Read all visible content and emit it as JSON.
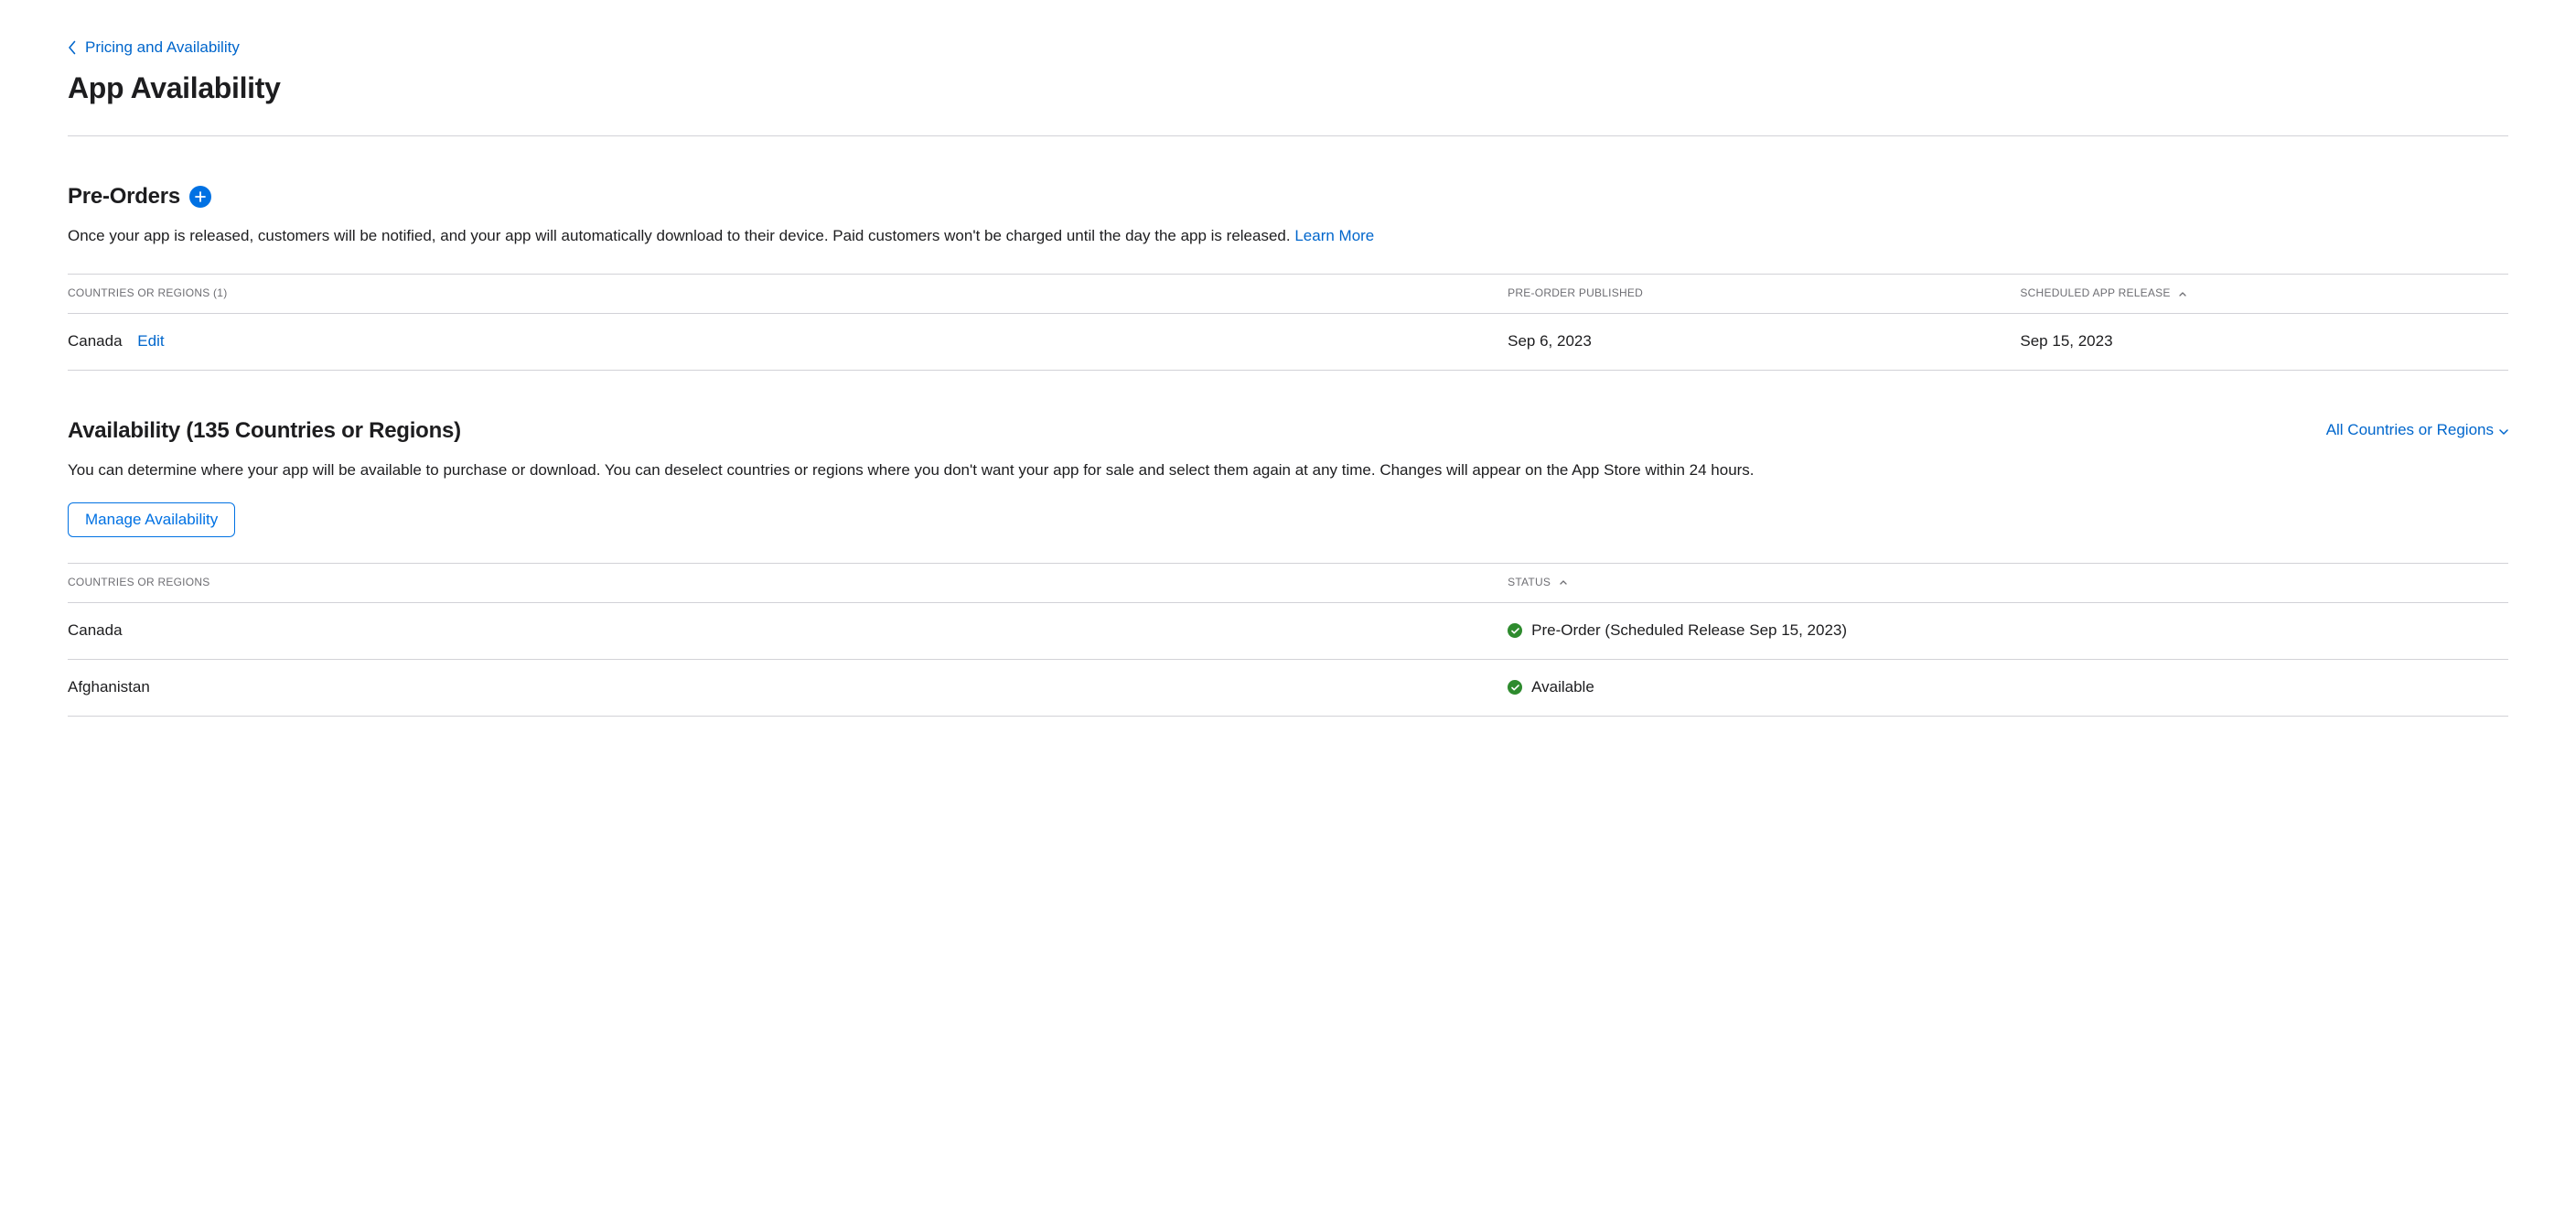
{
  "breadcrumb": {
    "label": "Pricing and Availability"
  },
  "page": {
    "title": "App Availability"
  },
  "preorders": {
    "title": "Pre-Orders",
    "description": "Once your app is released, customers will be notified, and your app will automatically download to their device. Paid customers won't be charged until the day the app is released. ",
    "learn_more": "Learn More",
    "columns": {
      "countries": "Countries or Regions (1)",
      "published": "Pre-Order Published",
      "release": "Scheduled App Release"
    },
    "rows": [
      {
        "country": "Canada",
        "edit": "Edit",
        "published": "Sep 6, 2023",
        "release": "Sep 15, 2023"
      }
    ]
  },
  "availability": {
    "title": "Availability (135 Countries or Regions)",
    "dropdown": "All Countries or Regions",
    "description": "You can determine where your app will be available to purchase or download. You can deselect countries or regions where you don't want your app for sale and select them again at any time. Changes will appear on the App Store within 24 hours.",
    "manage_button": "Manage Availability",
    "columns": {
      "countries": "Countries or Regions",
      "status": "Status"
    },
    "rows": [
      {
        "country": "Canada",
        "status": "Pre-Order (Scheduled Release Sep 15, 2023)"
      },
      {
        "country": "Afghanistan",
        "status": "Available"
      }
    ]
  }
}
